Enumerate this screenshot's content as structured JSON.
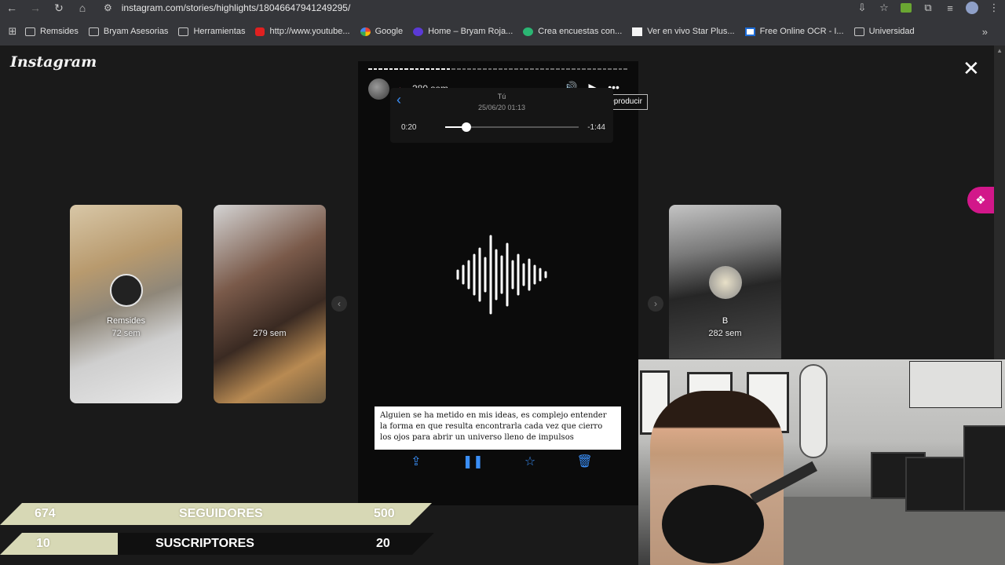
{
  "browser": {
    "url": "instagram.com/stories/highlights/18046647941249295/",
    "bookmarks": [
      {
        "label": "Remsides",
        "icon": "folder"
      },
      {
        "label": "Bryam Asesorias",
        "icon": "folder"
      },
      {
        "label": "Herramientas",
        "icon": "folder"
      },
      {
        "label": "http://www.youtube...",
        "icon": "yt"
      },
      {
        "label": "Google",
        "icon": "g"
      },
      {
        "label": "Home – Bryam Roja...",
        "icon": "home"
      },
      {
        "label": "Crea encuestas con...",
        "icon": "survey"
      },
      {
        "label": "Ver en vivo Star Plus...",
        "icon": "white"
      },
      {
        "label": "Free Online OCR - I...",
        "icon": "ocr"
      },
      {
        "label": "Universidad",
        "icon": "folder"
      }
    ]
  },
  "instagram": {
    "logo": "Instagram",
    "cards": [
      {
        "name": "Remsides",
        "time": "72 sem"
      },
      {
        "name": "",
        "time": "279 sem"
      },
      {
        "name": "B",
        "time": "282 sem"
      }
    ],
    "story": {
      "time_ago": "280 sem",
      "tooltip": "Reproducir",
      "inner_title": "Tú",
      "inner_date": "25/06/20 01:13",
      "elapsed": "0:20",
      "remaining": "-1:44",
      "playback_fraction": 0.16,
      "story_progress_fraction": 0.32,
      "caption": "Alguien se ha metido en mis ideas, es complejo entender la forma en que resulta encontrarla cada vez que cierro los ojos para abrir un universo lleno de impulsos"
    }
  },
  "stats": {
    "followers": {
      "current": "674",
      "label": "SEGUIDORES",
      "goal": "500"
    },
    "subscribers": {
      "current": "10",
      "label": "SUSCRIPTORES",
      "goal": "20"
    }
  },
  "colors": {
    "accent_pink": "#d2178a",
    "ios_blue": "#3a8ef6",
    "stats_band": "#d7d8b5"
  }
}
